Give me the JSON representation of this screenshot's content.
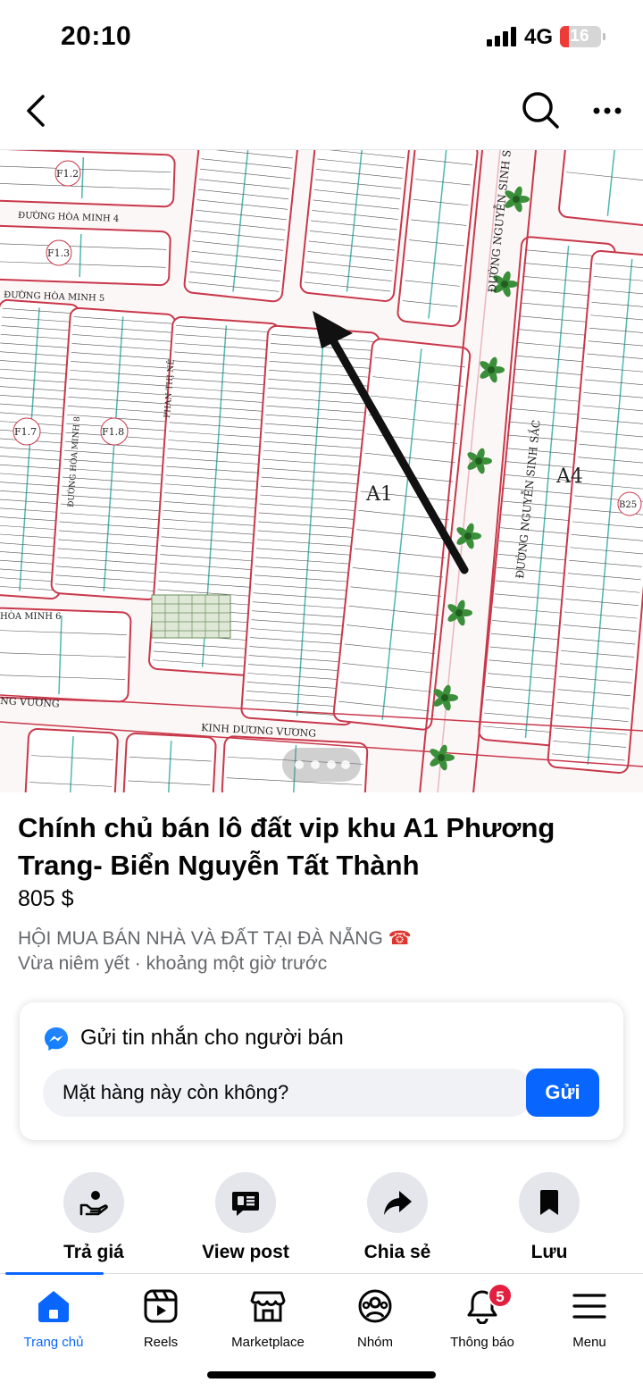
{
  "status_bar": {
    "time": "20:10",
    "network": "4G",
    "battery": "16"
  },
  "nav": {
    "back_icon": "chevron-left-icon",
    "search_icon": "search-icon",
    "more_icon": "more-horizontal-icon"
  },
  "photo": {
    "description_icon": "land-plot-map-image",
    "map_labels": {
      "block_a1": "A1",
      "block_a4": "A4",
      "block_f12": "F1.2",
      "block_f13": "F1.3",
      "block_f17": "F1.7",
      "block_f18": "F1.8",
      "block_b25": "B25",
      "street_nguyen_sinh_sac": "ĐƯỜNG NGUYỄN SINH SẮC",
      "street_hoa_minh_4": "ĐƯỜNG HÒA MINH 4",
      "street_hoa_minh_5": "ĐƯỜNG HÒA MINH 5",
      "street_hoa_minh_8": "ĐƯỜNG HÒA MINH 8",
      "street_hoa_minh_6": "HÒA MINH 6",
      "street_phan_thi_ne": "PHAN THỊ NÊ",
      "street_kinh_duong_vuong": "KINH DƯƠNG VƯƠNG",
      "street_vuong": "NG VƯƠNG"
    }
  },
  "listing": {
    "title": "Chính chủ bán lô đất vip khu A1 Phương Trang- Biển Nguyễn Tất Thành",
    "price": "805 $",
    "group": "HỘI MUA BÁN NHÀ VÀ ĐẤT TẠI ĐÀ NẴNG",
    "group_icon": "☎",
    "meta": "Vừa niêm yết · khoảng một giờ trước"
  },
  "message": {
    "heading": "Gửi tin nhắn cho người bán",
    "input_value": "Mặt hàng này còn không?",
    "send_label": "Gửi",
    "icon": "messenger-icon"
  },
  "actions": [
    {
      "label": "Trả giá",
      "icon": "hand-offer-icon"
    },
    {
      "label": "View post",
      "icon": "post-icon"
    },
    {
      "label": "Chia sẻ",
      "icon": "share-icon"
    },
    {
      "label": "Lưu",
      "icon": "bookmark-icon"
    }
  ],
  "tabs": [
    {
      "label": "Trang chủ",
      "icon": "home-icon",
      "active": true
    },
    {
      "label": "Reels",
      "icon": "reels-icon"
    },
    {
      "label": "Marketplace",
      "icon": "marketplace-icon"
    },
    {
      "label": "Nhóm",
      "icon": "groups-icon"
    },
    {
      "label": "Thông báo",
      "icon": "bell-icon",
      "badge": "5"
    },
    {
      "label": "Menu",
      "icon": "menu-icon"
    }
  ],
  "colors": {
    "accent": "#0866ff",
    "badge": "#e41e3f",
    "secondary_text": "#65676b",
    "map_red": "#c8384a",
    "map_teal": "#4fb7b0"
  }
}
